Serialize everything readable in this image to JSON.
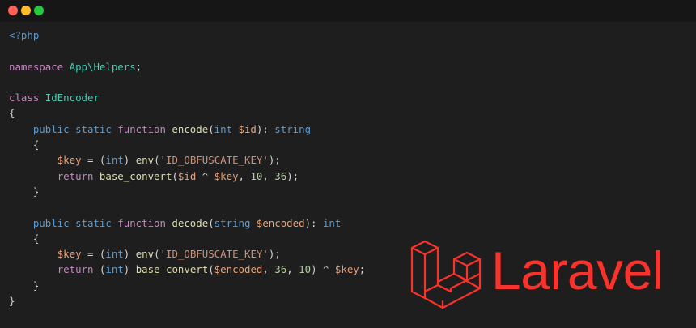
{
  "colors": {
    "background": "#1e1e1e",
    "titlebar": "#161616",
    "dot_red": "#ff5f56",
    "dot_yellow": "#ffbd2e",
    "dot_green": "#27c93f",
    "plain": "#d4d4d4",
    "php_tag": "#569cd6",
    "keyword": "#c586c0",
    "modifier": "#569cd6",
    "function_name": "#dcdcaa",
    "class_name": "#4ec9b0",
    "type": "#569cd6",
    "variable": "#e9a178",
    "string": "#ce9178",
    "number": "#b5cea8",
    "laravel": "#f9322c"
  },
  "code_lines": [
    [
      {
        "t": "<?php",
        "c": "php_tag"
      }
    ],
    [],
    [
      {
        "t": "namespace ",
        "c": "keyword"
      },
      {
        "t": "App\\Helpers",
        "c": "class_name"
      },
      {
        "t": ";",
        "c": "plain"
      }
    ],
    [],
    [
      {
        "t": "class ",
        "c": "keyword"
      },
      {
        "t": "IdEncoder",
        "c": "class_name"
      }
    ],
    [
      {
        "t": "{",
        "c": "plain"
      }
    ],
    [
      {
        "t": "    ",
        "c": "plain"
      },
      {
        "t": "public ",
        "c": "modifier"
      },
      {
        "t": "static ",
        "c": "modifier"
      },
      {
        "t": "function ",
        "c": "keyword"
      },
      {
        "t": "encode",
        "c": "function_name"
      },
      {
        "t": "(",
        "c": "plain"
      },
      {
        "t": "int ",
        "c": "type"
      },
      {
        "t": "$id",
        "c": "variable"
      },
      {
        "t": "): ",
        "c": "plain"
      },
      {
        "t": "string",
        "c": "type"
      }
    ],
    [
      {
        "t": "    {",
        "c": "plain"
      }
    ],
    [
      {
        "t": "        ",
        "c": "plain"
      },
      {
        "t": "$key",
        "c": "variable"
      },
      {
        "t": " = (",
        "c": "plain"
      },
      {
        "t": "int",
        "c": "type"
      },
      {
        "t": ") ",
        "c": "plain"
      },
      {
        "t": "env",
        "c": "function_name"
      },
      {
        "t": "(",
        "c": "plain"
      },
      {
        "t": "'ID_OBFUSCATE_KEY'",
        "c": "string"
      },
      {
        "t": ");",
        "c": "plain"
      }
    ],
    [
      {
        "t": "        ",
        "c": "plain"
      },
      {
        "t": "return ",
        "c": "keyword"
      },
      {
        "t": "base_convert",
        "c": "function_name"
      },
      {
        "t": "(",
        "c": "plain"
      },
      {
        "t": "$id",
        "c": "variable"
      },
      {
        "t": " ^ ",
        "c": "plain"
      },
      {
        "t": "$key",
        "c": "variable"
      },
      {
        "t": ", ",
        "c": "plain"
      },
      {
        "t": "10",
        "c": "number"
      },
      {
        "t": ", ",
        "c": "plain"
      },
      {
        "t": "36",
        "c": "number"
      },
      {
        "t": ");",
        "c": "plain"
      }
    ],
    [
      {
        "t": "    }",
        "c": "plain"
      }
    ],
    [],
    [
      {
        "t": "    ",
        "c": "plain"
      },
      {
        "t": "public ",
        "c": "modifier"
      },
      {
        "t": "static ",
        "c": "modifier"
      },
      {
        "t": "function ",
        "c": "keyword"
      },
      {
        "t": "decode",
        "c": "function_name"
      },
      {
        "t": "(",
        "c": "plain"
      },
      {
        "t": "string ",
        "c": "type"
      },
      {
        "t": "$encoded",
        "c": "variable"
      },
      {
        "t": "): ",
        "c": "plain"
      },
      {
        "t": "int",
        "c": "type"
      }
    ],
    [
      {
        "t": "    {",
        "c": "plain"
      }
    ],
    [
      {
        "t": "        ",
        "c": "plain"
      },
      {
        "t": "$key",
        "c": "variable"
      },
      {
        "t": " = (",
        "c": "plain"
      },
      {
        "t": "int",
        "c": "type"
      },
      {
        "t": ") ",
        "c": "plain"
      },
      {
        "t": "env",
        "c": "function_name"
      },
      {
        "t": "(",
        "c": "plain"
      },
      {
        "t": "'ID_OBFUSCATE_KEY'",
        "c": "string"
      },
      {
        "t": ");",
        "c": "plain"
      }
    ],
    [
      {
        "t": "        ",
        "c": "plain"
      },
      {
        "t": "return ",
        "c": "keyword"
      },
      {
        "t": "(",
        "c": "plain"
      },
      {
        "t": "int",
        "c": "type"
      },
      {
        "t": ") ",
        "c": "plain"
      },
      {
        "t": "base_convert",
        "c": "function_name"
      },
      {
        "t": "(",
        "c": "plain"
      },
      {
        "t": "$encoded",
        "c": "variable"
      },
      {
        "t": ", ",
        "c": "plain"
      },
      {
        "t": "36",
        "c": "number"
      },
      {
        "t": ", ",
        "c": "plain"
      },
      {
        "t": "10",
        "c": "number"
      },
      {
        "t": ") ^ ",
        "c": "plain"
      },
      {
        "t": "$key",
        "c": "variable"
      },
      {
        "t": ";",
        "c": "plain"
      }
    ],
    [
      {
        "t": "    }",
        "c": "plain"
      }
    ],
    [
      {
        "t": "}",
        "c": "plain"
      }
    ]
  ],
  "logo": {
    "text": "Laravel",
    "icon": "laravel-logo-icon"
  }
}
